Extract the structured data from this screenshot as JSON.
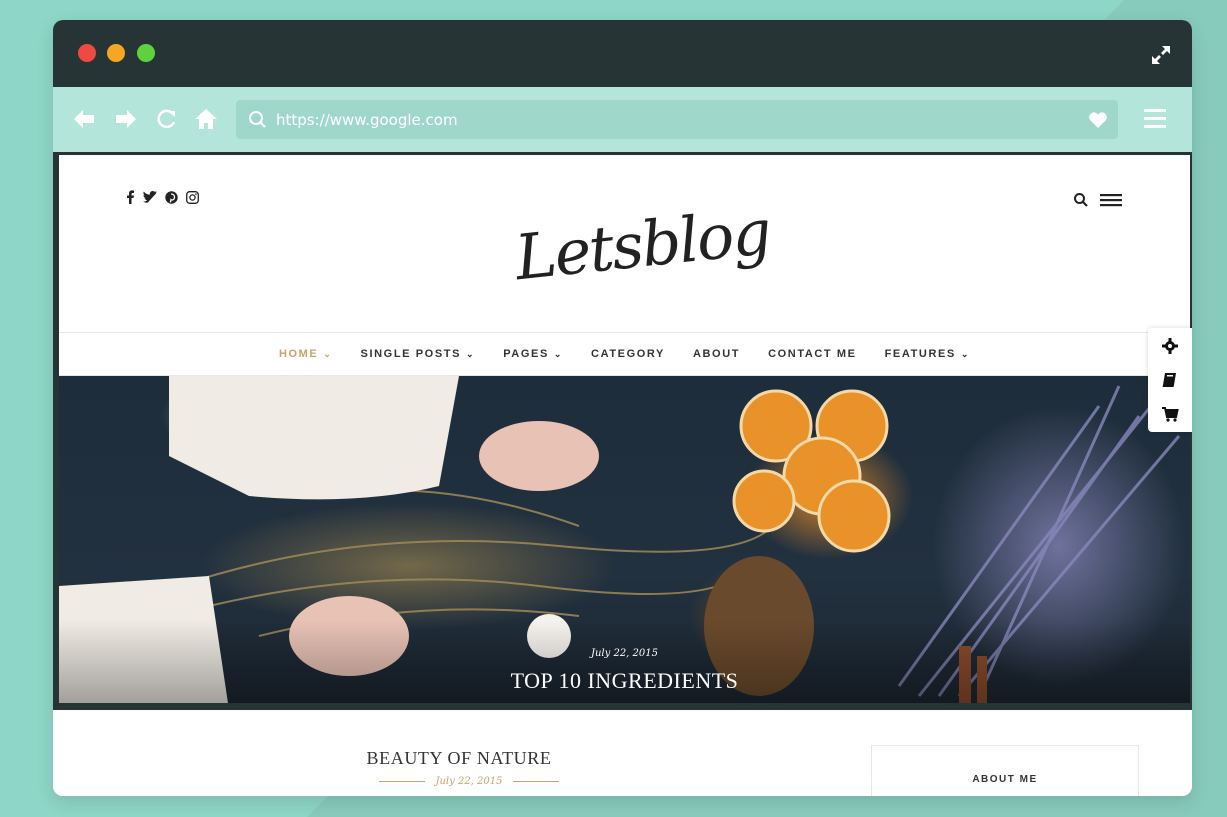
{
  "browser": {
    "url": "https://www.google.com",
    "accent_color": "#263436",
    "toolbar_color": "#b4e5da"
  },
  "site": {
    "logo_text": "Letsblog",
    "socials": [
      "facebook-icon",
      "twitter-icon",
      "pinterest-icon",
      "instagram-icon"
    ],
    "nav": [
      {
        "label": "HOME",
        "dropdown": true,
        "active": true
      },
      {
        "label": "SINGLE POSTS",
        "dropdown": true,
        "active": false
      },
      {
        "label": "PAGES",
        "dropdown": true,
        "active": false
      },
      {
        "label": "CATEGORY",
        "dropdown": false,
        "active": false
      },
      {
        "label": "ABOUT",
        "dropdown": false,
        "active": false
      },
      {
        "label": "CONTACT ME",
        "dropdown": false,
        "active": false
      },
      {
        "label": "FEATURES",
        "dropdown": true,
        "active": false
      }
    ],
    "active_color": "#c9a36b"
  },
  "hero": {
    "date": "July 22, 2015",
    "title": "TOP 10 INGREDIENTS"
  },
  "post": {
    "title": "BEAUTY OF NATURE",
    "date": "July 22, 2015"
  },
  "sidebar": {
    "about_label": "ABOUT ME"
  }
}
